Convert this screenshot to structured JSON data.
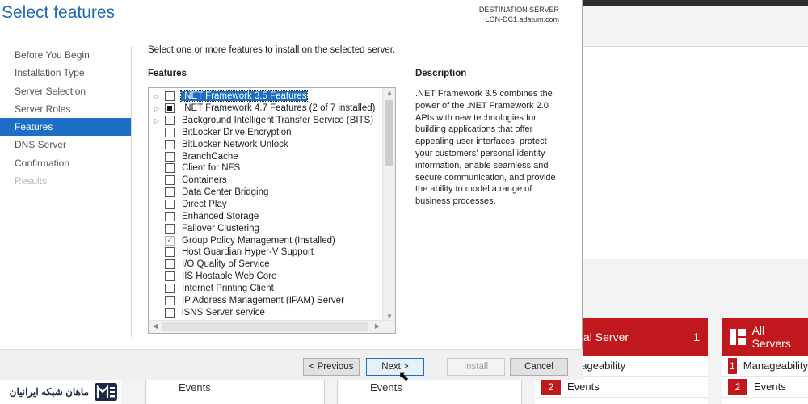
{
  "dialog": {
    "title": "Select features",
    "destination_label": "DESTINATION SERVER",
    "destination_server": "LON-DC1.adatum.com",
    "instruction": "Select one or more features to install on the selected server.",
    "features_heading": "Features",
    "description_heading": "Description",
    "description_text": ".NET Framework 3.5 combines the power of the .NET Framework 2.0 APIs with new technologies for building applications that offer appealing user interfaces, protect your customers' personal identity information, enable seamless and secure communication, and provide the ability to model a range of business processes."
  },
  "nav": {
    "items": [
      {
        "label": "Before You Begin",
        "state": "normal"
      },
      {
        "label": "Installation Type",
        "state": "normal"
      },
      {
        "label": "Server Selection",
        "state": "normal"
      },
      {
        "label": "Server Roles",
        "state": "normal"
      },
      {
        "label": "Features",
        "state": "active"
      },
      {
        "label": "DNS Server",
        "state": "normal"
      },
      {
        "label": "Confirmation",
        "state": "normal"
      },
      {
        "label": "Results",
        "state": "disabled"
      }
    ]
  },
  "features": [
    {
      "label": ".NET Framework 3.5 Features",
      "expandable": true,
      "check": "none",
      "selected": true
    },
    {
      "label": ".NET Framework 4.7 Features (2 of 7 installed)",
      "expandable": true,
      "check": "partial",
      "selected": false
    },
    {
      "label": "Background Intelligent Transfer Service (BITS)",
      "expandable": true,
      "check": "none",
      "selected": false
    },
    {
      "label": "BitLocker Drive Encryption",
      "expandable": false,
      "check": "none",
      "selected": false
    },
    {
      "label": "BitLocker Network Unlock",
      "expandable": false,
      "check": "none",
      "selected": false
    },
    {
      "label": "BranchCache",
      "expandable": false,
      "check": "none",
      "selected": false
    },
    {
      "label": "Client for NFS",
      "expandable": false,
      "check": "none",
      "selected": false
    },
    {
      "label": "Containers",
      "expandable": false,
      "check": "none",
      "selected": false
    },
    {
      "label": "Data Center Bridging",
      "expandable": false,
      "check": "none",
      "selected": false
    },
    {
      "label": "Direct Play",
      "expandable": false,
      "check": "none",
      "selected": false
    },
    {
      "label": "Enhanced Storage",
      "expandable": false,
      "check": "none",
      "selected": false
    },
    {
      "label": "Failover Clustering",
      "expandable": false,
      "check": "none",
      "selected": false
    },
    {
      "label": "Group Policy Management (Installed)",
      "expandable": false,
      "check": "checked",
      "selected": false
    },
    {
      "label": "Host Guardian Hyper-V Support",
      "expandable": false,
      "check": "none",
      "selected": false
    },
    {
      "label": "I/O Quality of Service",
      "expandable": false,
      "check": "none",
      "selected": false
    },
    {
      "label": "IIS Hostable Web Core",
      "expandable": false,
      "check": "none",
      "selected": false
    },
    {
      "label": "Internet Printing Client",
      "expandable": false,
      "check": "none",
      "selected": false
    },
    {
      "label": "IP Address Management (IPAM) Server",
      "expandable": false,
      "check": "none",
      "selected": false
    },
    {
      "label": "iSNS Server service",
      "expandable": false,
      "check": "none",
      "selected": false
    }
  ],
  "buttons": {
    "previous": "< Previous",
    "next": "Next >",
    "install": "Install",
    "cancel": "Cancel"
  },
  "background": {
    "tile_local": {
      "title": "al Server",
      "count": "1",
      "row1": "nageability",
      "row2_badge": "2",
      "row2": "Events"
    },
    "tile_all": {
      "title": "All Servers",
      "row1_badge": "1",
      "row1": "Manageability",
      "row2_badge": "2",
      "row2": "Events"
    },
    "col1_events": "Events",
    "col2_events": "Events"
  },
  "logo": {
    "text": "ماهان شبکه ایرانیان"
  },
  "colors": {
    "accent": "#1c6fc5",
    "title": "#1e6ab4",
    "tile_red": "#c0181c"
  }
}
